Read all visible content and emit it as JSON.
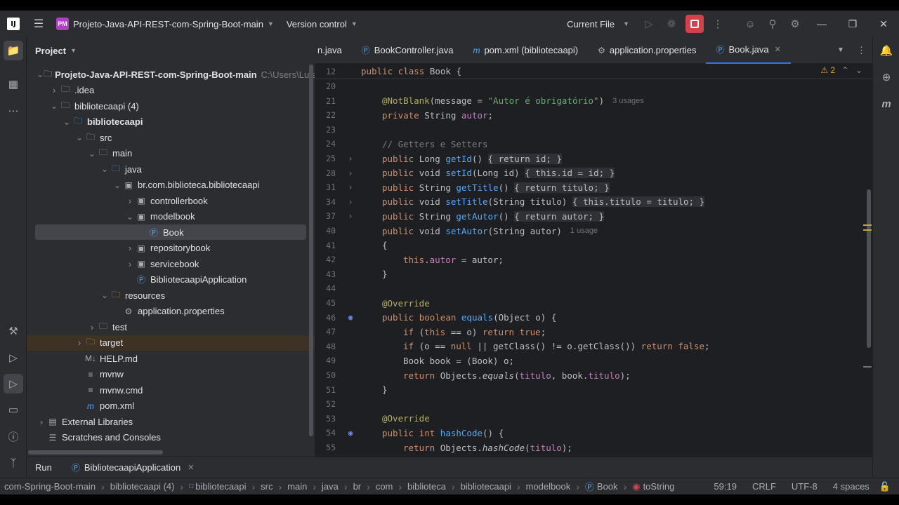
{
  "titlebar": {
    "logo": "IJ",
    "project_badge": "PM",
    "project_name": "Projeto-Java-API-REST-com-Spring-Boot-main",
    "version_control": "Version control",
    "run_config": "Current File"
  },
  "project_panel": {
    "title": "Project",
    "tree": [
      {
        "label": "Projeto-Java-API-REST-com-Spring-Boot-main",
        "hint": "C:\\Users\\Luis",
        "icon": "folder-icon",
        "depth": 0,
        "expanded": true,
        "bold": true
      },
      {
        "label": ".idea",
        "icon": "folder-icon",
        "depth": 1,
        "expanded": false
      },
      {
        "label": "bibliotecaapi (4)",
        "icon": "folder-icon",
        "depth": 1,
        "expanded": true
      },
      {
        "label": "bibliotecaapi",
        "icon": "module-folder-icon",
        "depth": 2,
        "expanded": true,
        "bold": true
      },
      {
        "label": "src",
        "icon": "folder-icon",
        "depth": 3,
        "expanded": true
      },
      {
        "label": "main",
        "icon": "folder-icon",
        "depth": 4,
        "expanded": true
      },
      {
        "label": "java",
        "icon": "source-folder-icon",
        "depth": 5,
        "expanded": true
      },
      {
        "label": "br.com.biblioteca.bibliotecaapi",
        "icon": "package-icon",
        "depth": 6,
        "expanded": true
      },
      {
        "label": "controllerbook",
        "icon": "package-icon",
        "depth": 7,
        "expanded": false
      },
      {
        "label": "modelbook",
        "icon": "package-icon",
        "depth": 7,
        "expanded": true
      },
      {
        "label": "Book",
        "icon": "class-icon",
        "depth": 8,
        "selected": true
      },
      {
        "label": "repositorybook",
        "icon": "package-icon",
        "depth": 7,
        "expanded": false
      },
      {
        "label": "servicebook",
        "icon": "package-icon",
        "depth": 7,
        "expanded": false
      },
      {
        "label": "BibliotecaapiApplication",
        "icon": "spring-class-icon",
        "depth": 7
      },
      {
        "label": "resources",
        "icon": "resources-folder-icon",
        "depth": 5,
        "expanded": true
      },
      {
        "label": "application.properties",
        "icon": "settings-file-icon",
        "depth": 6
      },
      {
        "label": "test",
        "icon": "folder-icon",
        "depth": 4,
        "expanded": false
      },
      {
        "label": "target",
        "icon": "excluded-folder-icon",
        "depth": 3,
        "expanded": false,
        "highlight": true
      },
      {
        "label": "HELP.md",
        "icon": "markdown-icon",
        "depth": 3
      },
      {
        "label": "mvnw",
        "icon": "text-file-icon",
        "depth": 3
      },
      {
        "label": "mvnw.cmd",
        "icon": "text-file-icon",
        "depth": 3
      },
      {
        "label": "pom.xml",
        "icon": "maven-icon",
        "depth": 3
      },
      {
        "label": "External Libraries",
        "icon": "library-icon",
        "depth": 0,
        "expanded": false
      },
      {
        "label": "Scratches and Consoles",
        "icon": "scratches-icon",
        "depth": 0
      }
    ]
  },
  "tabs": [
    {
      "label": "n.java",
      "icon": "class-icon"
    },
    {
      "label": "BookController.java",
      "icon": "class-icon"
    },
    {
      "label": "pom.xml (bibliotecaapi)",
      "icon": "maven-icon"
    },
    {
      "label": "application.properties",
      "icon": "settings-file-icon"
    },
    {
      "label": "Book.java",
      "icon": "class-icon",
      "active": true
    }
  ],
  "editor": {
    "sticky_line_no": "12",
    "sticky_line": [
      "public",
      " ",
      "class",
      " Book {"
    ],
    "warning_count": "2",
    "line_numbers": [
      "20",
      "21",
      "22",
      "23",
      "24",
      "25",
      "28",
      "31",
      "34",
      "37",
      "40",
      "41",
      "42",
      "43",
      "44",
      "45",
      "46",
      "47",
      "48",
      "49",
      "50",
      "51",
      "52",
      "53",
      "54",
      "55"
    ],
    "hints": {
      "autor_usages": "3 usages",
      "setautor_usage": "1 usage"
    },
    "lines": {
      "l21": [
        "@NotBlank",
        "(message = ",
        "\"Autor é obrigatório\"",
        ")"
      ],
      "l22": [
        "private ",
        "String ",
        "autor",
        ";"
      ],
      "l24": "// Getters e Setters",
      "l25": [
        "public ",
        "Long ",
        "getId",
        "() ",
        "{ ",
        "return ",
        "id",
        "; }"
      ],
      "l28": [
        "public ",
        "void ",
        "setId",
        "(Long id) ",
        "{ ",
        "this",
        ".",
        "id",
        " = id; }"
      ],
      "l31": [
        "public ",
        "String ",
        "getTitle",
        "() ",
        "{ ",
        "return ",
        "titulo",
        "; }"
      ],
      "l34": [
        "public ",
        "void ",
        "setTitle",
        "(String titulo) ",
        "{ ",
        "this",
        ".",
        "titulo",
        " = titulo; }"
      ],
      "l37": [
        "public ",
        "String ",
        "getAutor",
        "() ",
        "{ ",
        "return ",
        "autor",
        "; }"
      ],
      "l40": [
        "public ",
        "void ",
        "setAutor",
        "(String autor)"
      ],
      "l41": "{",
      "l42": [
        "this",
        ".",
        "autor",
        " = autor;"
      ],
      "l43": "}",
      "l45": "@Override",
      "l46": [
        "public ",
        "boolean ",
        "equals",
        "(Object o) {"
      ],
      "l47": [
        "if ",
        "(",
        "this",
        " == o) ",
        "return ",
        "true",
        ";"
      ],
      "l48": [
        "if ",
        "(o == ",
        "null",
        " || getClass() != o.getClass()) ",
        "return ",
        "false",
        ";"
      ],
      "l49": "Book book = (Book) o;",
      "l50": [
        "return ",
        "Objects.",
        "equals",
        "(",
        "titulo",
        ", book.",
        "titulo",
        ");"
      ],
      "l51": "}",
      "l53": "@Override",
      "l54": [
        "public ",
        "int ",
        "hashCode",
        "() {"
      ],
      "l55": [
        "return ",
        "Objects.",
        "hashCode",
        "(",
        "titulo",
        ");"
      ]
    }
  },
  "runbar": {
    "run_label": "Run",
    "run_tab": "BibliotecaapiApplication"
  },
  "statusbar": {
    "breadcrumbs": [
      "com-Spring-Boot-main",
      "bibliotecaapi (4)",
      "bibliotecaapi",
      "src",
      "main",
      "java",
      "br",
      "com",
      "biblioteca",
      "bibliotecaapi",
      "modelbook",
      "Book",
      "toString"
    ],
    "position": "59:19",
    "line_sep": "CRLF",
    "encoding": "UTF-8",
    "indent": "4 spaces"
  },
  "colors": {
    "accent": "#3574f0",
    "stop": "#d1434c",
    "keyword": "#cf8e6d",
    "function": "#56a8f5",
    "string": "#6aab73",
    "annotation": "#b3ae60",
    "field": "#c77dbb"
  }
}
